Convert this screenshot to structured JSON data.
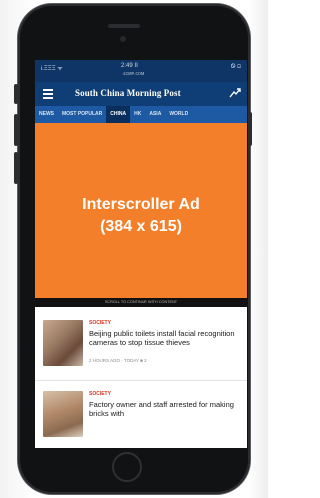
{
  "device": {
    "frame_color": "#111214"
  },
  "status_bar": {
    "carrier": "Ꭵ.ΞΞΞ ᯤ",
    "time": "2:49 ⅠⅠ",
    "url": "ꜱᴄᴍᴘ.ᴄᴏᴍ",
    "battery": "Ꮻ ⊡"
  },
  "app": {
    "title": "South China Morning Post",
    "header_color": "#0f3d75",
    "tab_bar_color": "#1d5aa3"
  },
  "tabs": [
    "NEWS",
    "MOST POPULAR",
    "CHINA",
    "HK",
    "ASIA",
    "WORLD"
  ],
  "active_tab": "CHINA",
  "ad": {
    "line1": "Interscroller Ad",
    "line2": "(384 x 615)",
    "color": "#f47f2a",
    "strip_text": "SCROLL TO CONTINUE WITH CONTENT"
  },
  "articles": [
    {
      "tag": "SOCIETY",
      "headline": "Beijing public toilets install facial recognition cameras to stop tissue thieves",
      "meta": "2 HOURS AGO  ·  TODAY  ■ 2"
    },
    {
      "tag": "SOCIETY",
      "headline": "Factory owner and staff arrested for making bricks with"
    }
  ],
  "icons": [
    "menu-icon",
    "trend-icon",
    "home-button"
  ]
}
